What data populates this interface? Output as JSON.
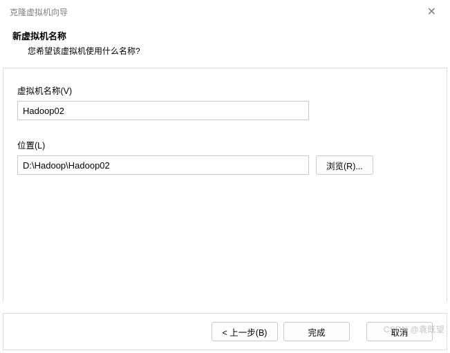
{
  "titlebar": {
    "title": "克隆虚拟机向导",
    "close_glyph": "✕"
  },
  "header": {
    "title": "新虚拟机名称",
    "subtitle": "您希望该虚拟机使用什么名称?"
  },
  "form": {
    "name_label": "虚拟机名称(V)",
    "name_value": "Hadoop02",
    "location_label": "位置(L)",
    "location_value": "D:\\Hadoop\\Hadoop02",
    "browse_label": "浏览(R)..."
  },
  "buttons": {
    "back": "< 上一步(B)",
    "finish": "完成",
    "cancel": "取消"
  },
  "watermark": "CSDN @袁既望"
}
